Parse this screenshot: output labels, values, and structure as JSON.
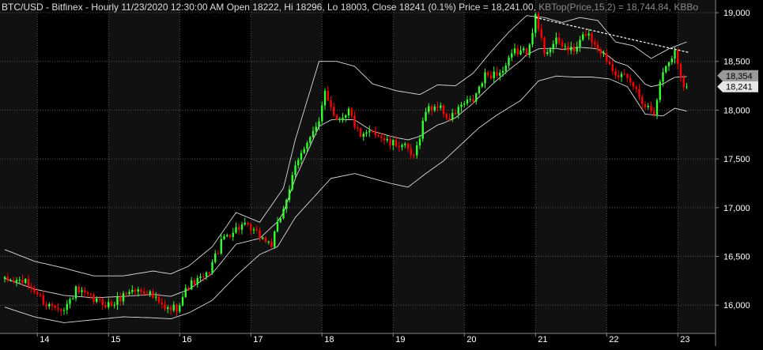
{
  "header": {
    "symbol": "BTC/USD",
    "info": " - Bitfinex - Hourly 11/23/2020 12:30:00 AM Open 18222, Hi 18296, Lo 18003, Close 18241 (0.1%)",
    "price": " Price = 18,241.00,",
    "indicator": " KBTop(Price,15,2) = 18,744.84,",
    "indicator2": " KBBo"
  },
  "colors": {
    "background": "#000000",
    "panel_shade": "#111111",
    "up": "#33ff33",
    "down": "#ff0000",
    "band": "#ffffff",
    "grid": "#555555",
    "text": "#ffffff",
    "header_text": "#dddddd",
    "indicator_text": "#8a8a8a"
  },
  "price_flags": [
    {
      "label": "18,354",
      "value": 18354,
      "bg": "#9a9a9a",
      "fg": "#000000"
    },
    {
      "label": "18,241",
      "value": 18241,
      "bg": "#e6e6e6",
      "fg": "#000000"
    }
  ],
  "chart_data": {
    "type": "candlestick",
    "title": "BTC/USD - Bitfinex - Hourly",
    "ylim": [
      15710,
      19130
    ],
    "y_ticks": [
      {
        "value": 16000,
        "label": "16,000"
      },
      {
        "value": 16500,
        "label": "16,500"
      },
      {
        "value": 17000,
        "label": "17,000"
      },
      {
        "value": 17500,
        "label": "17,500"
      },
      {
        "value": 18000,
        "label": "18,000"
      },
      {
        "value": 18500,
        "label": "18,500"
      },
      {
        "value": 19000,
        "label": "19,000"
      }
    ],
    "x_ticks": [
      {
        "label": "14",
        "bar": 11
      },
      {
        "label": "15",
        "bar": 35
      },
      {
        "label": "16",
        "bar": 59
      },
      {
        "label": "17",
        "bar": 83
      },
      {
        "label": "18",
        "bar": 107
      },
      {
        "label": "19",
        "bar": 131
      },
      {
        "label": "20",
        "bar": 155
      },
      {
        "label": "21",
        "bar": 179
      },
      {
        "label": "22",
        "bar": 203
      },
      {
        "label": "23",
        "bar": 227
      }
    ],
    "close_anchors": [
      [
        0,
        16250
      ],
      [
        6,
        16250
      ],
      [
        10,
        16150
      ],
      [
        14,
        16000
      ],
      [
        18,
        16000
      ],
      [
        20,
        15950
      ],
      [
        24,
        16150
      ],
      [
        30,
        16050
      ],
      [
        36,
        16000
      ],
      [
        42,
        16150
      ],
      [
        48,
        16150
      ],
      [
        54,
        15950
      ],
      [
        58,
        15980
      ],
      [
        62,
        16200
      ],
      [
        68,
        16300
      ],
      [
        74,
        16700
      ],
      [
        80,
        16820
      ],
      [
        84,
        16750
      ],
      [
        90,
        16620
      ],
      [
        94,
        17000
      ],
      [
        98,
        17400
      ],
      [
        102,
        17700
      ],
      [
        106,
        17850
      ],
      [
        108,
        18200
      ],
      [
        112,
        17900
      ],
      [
        116,
        18000
      ],
      [
        120,
        17700
      ],
      [
        124,
        17800
      ],
      [
        130,
        17650
      ],
      [
        134,
        17650
      ],
      [
        138,
        17500
      ],
      [
        142,
        18000
      ],
      [
        146,
        18050
      ],
      [
        150,
        17900
      ],
      [
        154,
        18050
      ],
      [
        158,
        18100
      ],
      [
        162,
        18350
      ],
      [
        168,
        18400
      ],
      [
        172,
        18600
      ],
      [
        176,
        18600
      ],
      [
        179,
        18950
      ],
      [
        182,
        18600
      ],
      [
        186,
        18700
      ],
      [
        192,
        18600
      ],
      [
        196,
        18800
      ],
      [
        200,
        18650
      ],
      [
        206,
        18400
      ],
      [
        212,
        18250
      ],
      [
        216,
        18050
      ],
      [
        219,
        18000
      ],
      [
        222,
        18400
      ],
      [
        226,
        18600
      ],
      [
        229,
        18250
      ],
      [
        230,
        18241
      ]
    ],
    "upper_band_anchors": [
      [
        0,
        16570
      ],
      [
        10,
        16450
      ],
      [
        20,
        16380
      ],
      [
        30,
        16300
      ],
      [
        40,
        16300
      ],
      [
        50,
        16350
      ],
      [
        56,
        16320
      ],
      [
        62,
        16400
      ],
      [
        70,
        16600
      ],
      [
        78,
        16950
      ],
      [
        86,
        16850
      ],
      [
        94,
        17200
      ],
      [
        98,
        17700
      ],
      [
        104,
        18300
      ],
      [
        106,
        18500
      ],
      [
        112,
        18500
      ],
      [
        118,
        18450
      ],
      [
        124,
        18270
      ],
      [
        132,
        18200
      ],
      [
        140,
        18160
      ],
      [
        146,
        18260
      ],
      [
        152,
        18250
      ],
      [
        158,
        18380
      ],
      [
        164,
        18600
      ],
      [
        170,
        18800
      ],
      [
        176,
        18970
      ],
      [
        182,
        18950
      ],
      [
        188,
        18900
      ],
      [
        194,
        18950
      ],
      [
        200,
        18920
      ],
      [
        206,
        18700
      ],
      [
        212,
        18660
      ],
      [
        218,
        18530
      ],
      [
        224,
        18630
      ],
      [
        230,
        18700
      ]
    ],
    "lower_band_anchors": [
      [
        0,
        15980
      ],
      [
        10,
        15880
      ],
      [
        20,
        15820
      ],
      [
        30,
        15850
      ],
      [
        40,
        15880
      ],
      [
        50,
        15870
      ],
      [
        56,
        15860
      ],
      [
        62,
        15920
      ],
      [
        70,
        16050
      ],
      [
        78,
        16300
      ],
      [
        86,
        16520
      ],
      [
        92,
        16600
      ],
      [
        98,
        16900
      ],
      [
        104,
        17100
      ],
      [
        110,
        17300
      ],
      [
        118,
        17350
      ],
      [
        124,
        17300
      ],
      [
        130,
        17250
      ],
      [
        136,
        17210
      ],
      [
        142,
        17350
      ],
      [
        148,
        17480
      ],
      [
        154,
        17650
      ],
      [
        160,
        17820
      ],
      [
        166,
        17950
      ],
      [
        174,
        18100
      ],
      [
        180,
        18300
      ],
      [
        186,
        18350
      ],
      [
        192,
        18340
      ],
      [
        198,
        18340
      ],
      [
        204,
        18320
      ],
      [
        210,
        18240
      ],
      [
        216,
        17960
      ],
      [
        222,
        17940
      ],
      [
        226,
        18020
      ],
      [
        230,
        17990
      ]
    ],
    "trendline": {
      "from": {
        "bar": 179,
        "value": 18950
      },
      "to": {
        "bar": 231,
        "value": 18590
      },
      "style": "dashed"
    },
    "bar_count": 231,
    "grid": true,
    "last_close": 18241
  }
}
